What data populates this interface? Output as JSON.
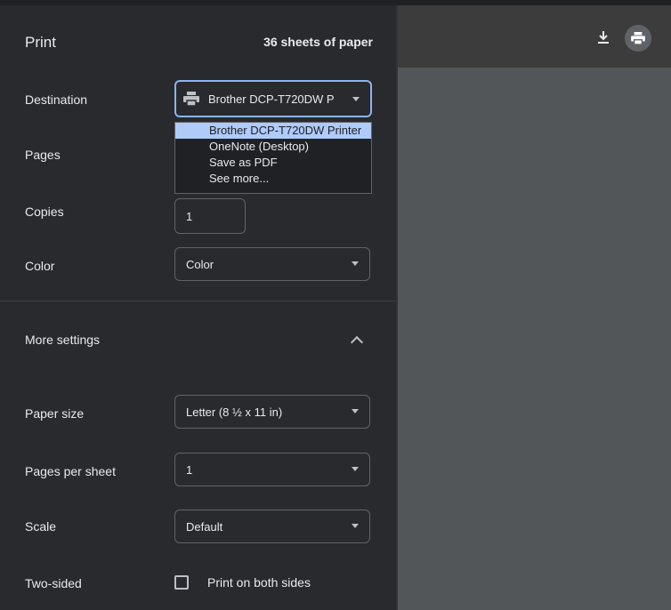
{
  "header": {
    "title": "Print",
    "sheets": "36 sheets of paper"
  },
  "destination": {
    "label": "Destination",
    "value": "Brother DCP-T720DW P",
    "options": [
      "Brother DCP-T720DW Printer",
      "OneNote (Desktop)",
      "Save as PDF",
      "See more..."
    ]
  },
  "pages": {
    "label": "Pages"
  },
  "copies": {
    "label": "Copies",
    "value": "1"
  },
  "color": {
    "label": "Color",
    "value": "Color"
  },
  "more_settings": {
    "label": "More settings"
  },
  "paper_size": {
    "label": "Paper size",
    "value": "Letter (8 ½ x 11 in)"
  },
  "pages_per_sheet": {
    "label": "Pages per sheet",
    "value": "1"
  },
  "scale": {
    "label": "Scale",
    "value": "Default"
  },
  "two_sided": {
    "label": "Two-sided",
    "option": "Print on both sides",
    "checked": false
  },
  "preview": {
    "icons": [
      "download-icon",
      "print-icon"
    ]
  }
}
